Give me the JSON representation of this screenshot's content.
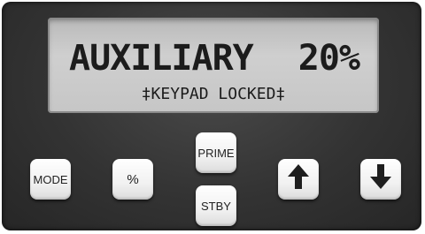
{
  "display": {
    "mode": "AUXILIARY",
    "value": "20%",
    "status": "‡KEYPAD LOCKED‡"
  },
  "buttons": {
    "mode": "MODE",
    "percent": "%",
    "prime": "PRIME",
    "stby": "STBY",
    "up_icon": "arrow-up-icon",
    "down_icon": "arrow-down-icon"
  }
}
